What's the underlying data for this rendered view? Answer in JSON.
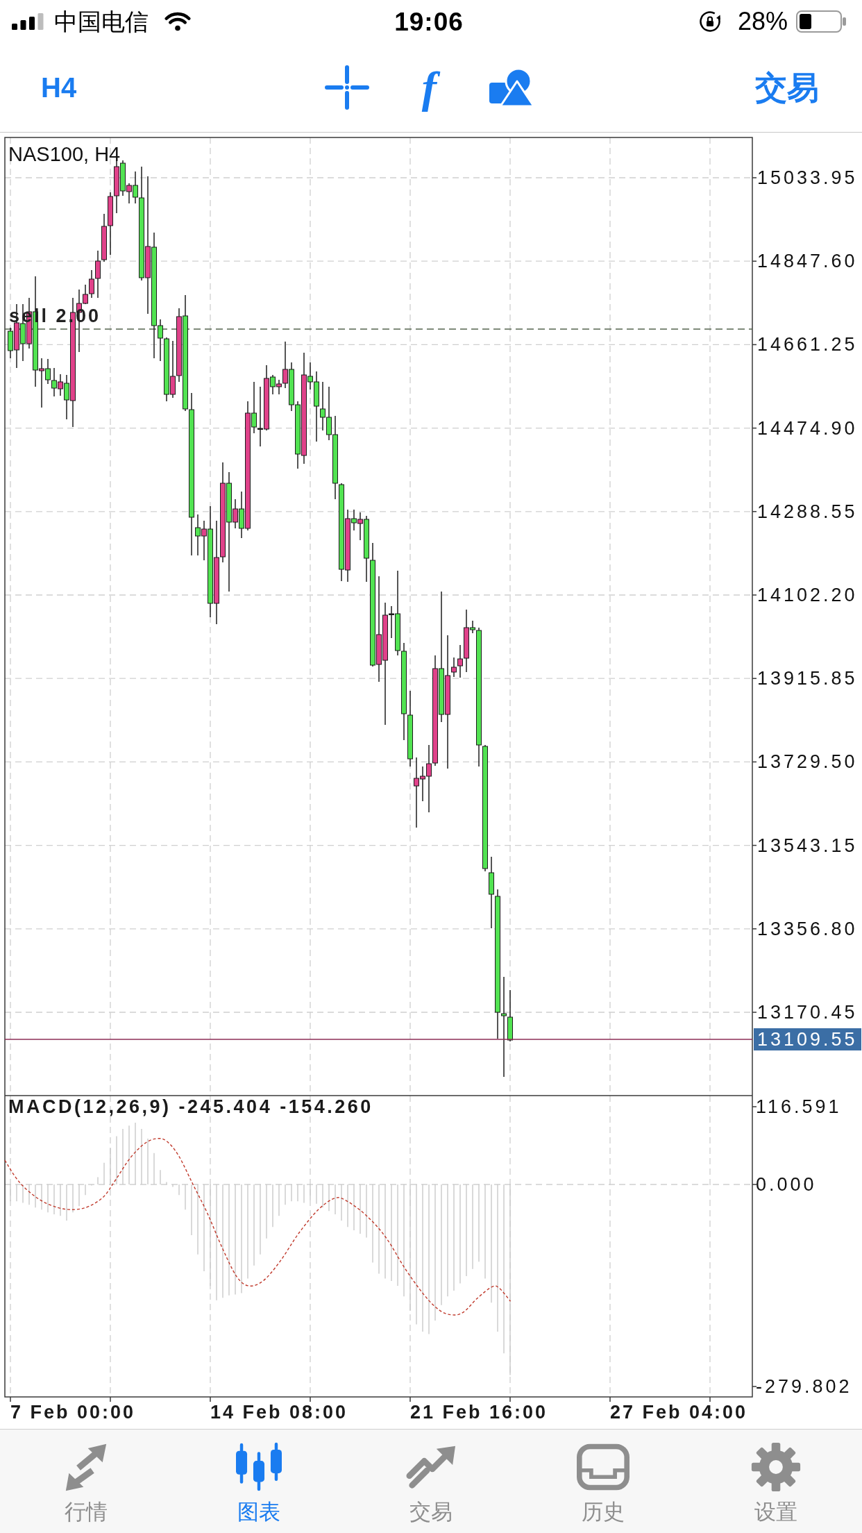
{
  "status_bar": {
    "carrier": "中国电信",
    "time": "19:06",
    "battery": "28%"
  },
  "toolbar": {
    "timeframe": "H4",
    "indicator_glyph": "f",
    "trade": "交易"
  },
  "chart": {
    "symbol": "NAS100, H4",
    "order_line": "sell 2.00",
    "price_ticks": [
      "15033.95",
      "14847.60",
      "14661.25",
      "14474.90",
      "14288.55",
      "14102.20",
      "13915.85",
      "13729.50",
      "13543.15",
      "13356.80",
      "13170.45"
    ],
    "current_price": "13109.55",
    "indicator": "MACD(12,26,9) -245.404 -154.260",
    "indicator_ticks": [
      "116.591",
      "0.000",
      "-279.802"
    ],
    "time_ticks": [
      "7 Feb 00:00",
      "14 Feb 08:00",
      "21 Feb 16:00",
      "27 Feb 04:00"
    ]
  },
  "tab_bar": [
    {
      "label": "行情",
      "selected": false
    },
    {
      "label": "图表",
      "selected": true
    },
    {
      "label": "交易",
      "selected": false
    },
    {
      "label": "历史",
      "selected": false
    },
    {
      "label": "设置",
      "selected": false
    }
  ]
}
